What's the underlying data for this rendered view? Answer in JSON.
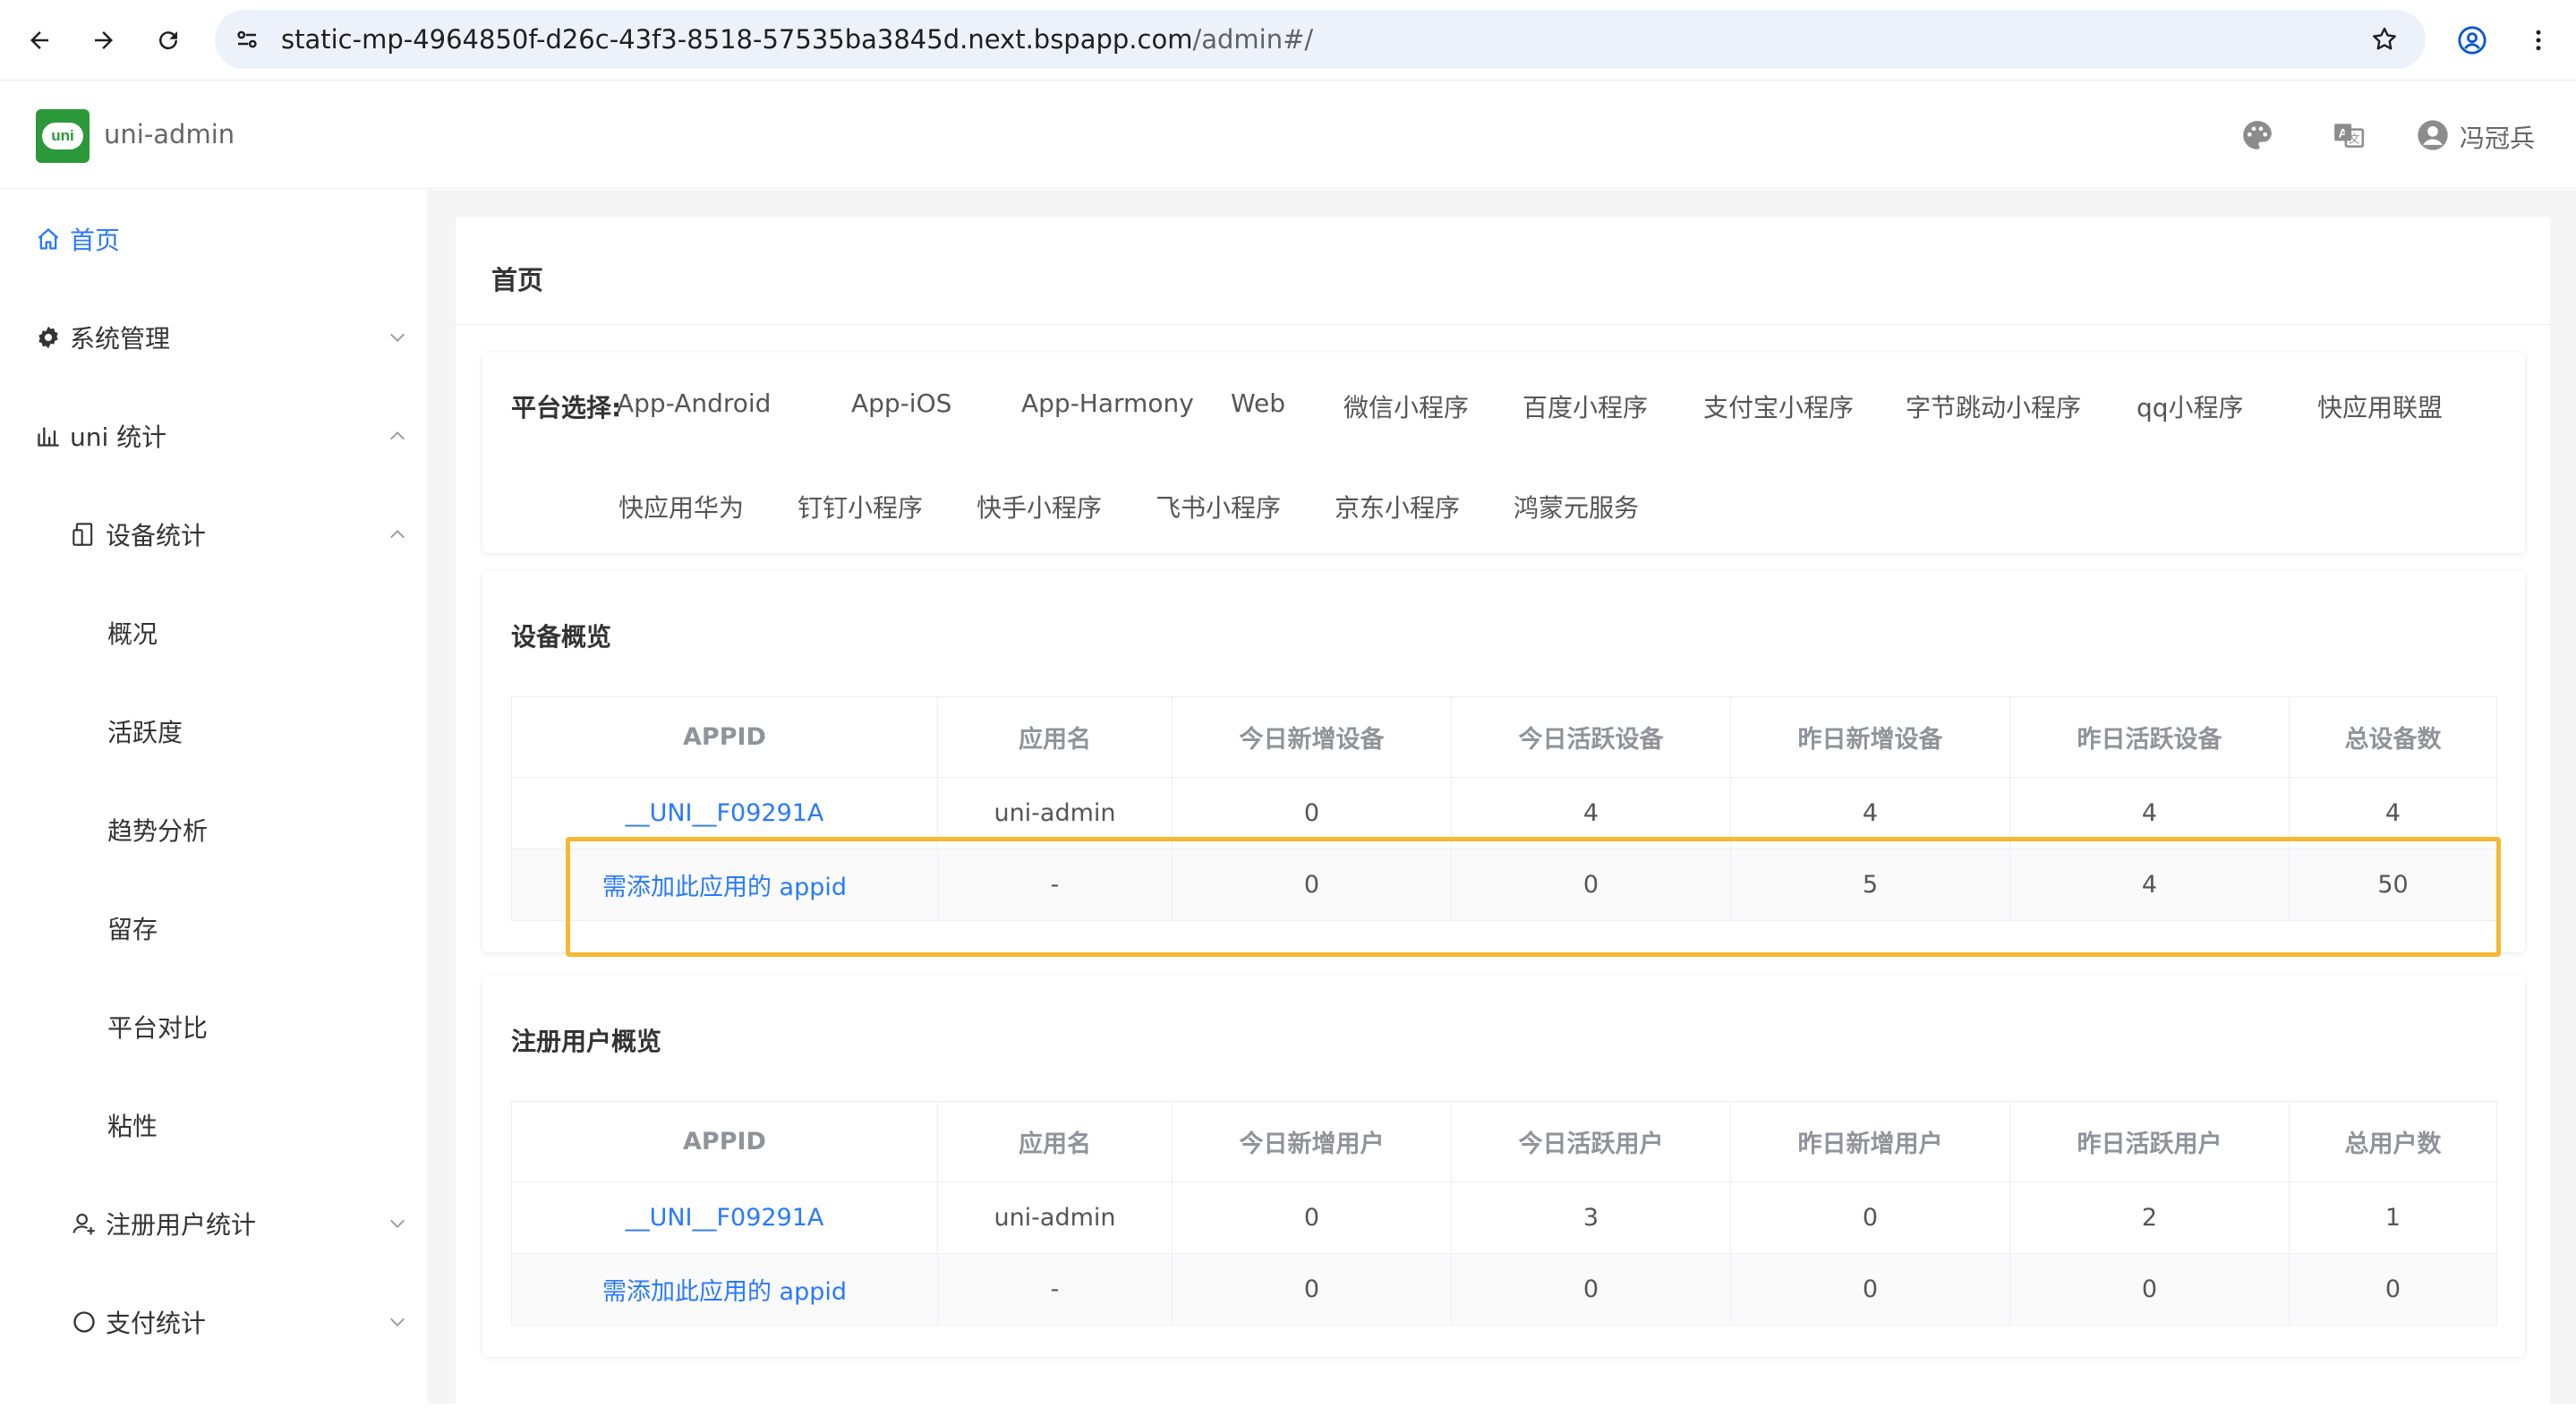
{
  "browser": {
    "url_host": "static-mp-4964850f-d26c-43f3-8518-57535ba3845d.next.bspapp.com",
    "url_path": "/admin#/"
  },
  "header": {
    "app_name": "uni-admin",
    "logo_text": "uni",
    "user_name": "冯冠兵",
    "brand_color": "#2b9939"
  },
  "sidebar": {
    "items": [
      {
        "label": "首页",
        "icon": "home-icon",
        "active": true
      },
      {
        "label": "系统管理",
        "icon": "gear-icon"
      },
      {
        "label": "uni 统计",
        "icon": "chart-icon"
      },
      {
        "label": "设备统计",
        "icon": "device-icon"
      },
      {
        "label": "概况"
      },
      {
        "label": "活跃度"
      },
      {
        "label": "趋势分析"
      },
      {
        "label": "留存"
      },
      {
        "label": "平台对比"
      },
      {
        "label": "粘性"
      },
      {
        "label": "注册用户统计",
        "icon": "user-icon"
      },
      {
        "label": "支付统计",
        "icon": "circle-icon"
      }
    ]
  },
  "page": {
    "title": "首页",
    "platform": {
      "label": "平台选择:",
      "options": [
        "App-Android",
        "App-iOS",
        "App-Harmony",
        "Web",
        "微信小程序",
        "百度小程序",
        "支付宝小程序",
        "字节跳动小程序",
        "qq小程序",
        "快应用联盟",
        "快应用华为",
        "钉钉小程序",
        "快手小程序",
        "飞书小程序",
        "京东小程序",
        "鸿蒙元服务"
      ]
    },
    "device_overview": {
      "title": "设备概览",
      "headers": [
        "APPID",
        "应用名",
        "今日新增设备",
        "今日活跃设备",
        "昨日新增设备",
        "昨日活跃设备",
        "总设备数"
      ],
      "rows": [
        [
          "__UNI__F09291A",
          "uni-admin",
          "0",
          "4",
          "4",
          "4",
          "4"
        ],
        [
          "需添加此应用的 appid",
          "-",
          "0",
          "0",
          "5",
          "4",
          "50"
        ]
      ]
    },
    "user_overview": {
      "title": "注册用户概览",
      "headers": [
        "APPID",
        "应用名",
        "今日新增用户",
        "今日活跃用户",
        "昨日新增用户",
        "昨日活跃用户",
        "总用户数"
      ],
      "rows": [
        [
          "__UNI__F09291A",
          "uni-admin",
          "0",
          "3",
          "0",
          "2",
          "1"
        ],
        [
          "需添加此应用的 appid",
          "-",
          "0",
          "0",
          "0",
          "0",
          "0"
        ]
      ]
    }
  },
  "colors": {
    "link": "#2979ff",
    "highlight": "#f6b731"
  }
}
